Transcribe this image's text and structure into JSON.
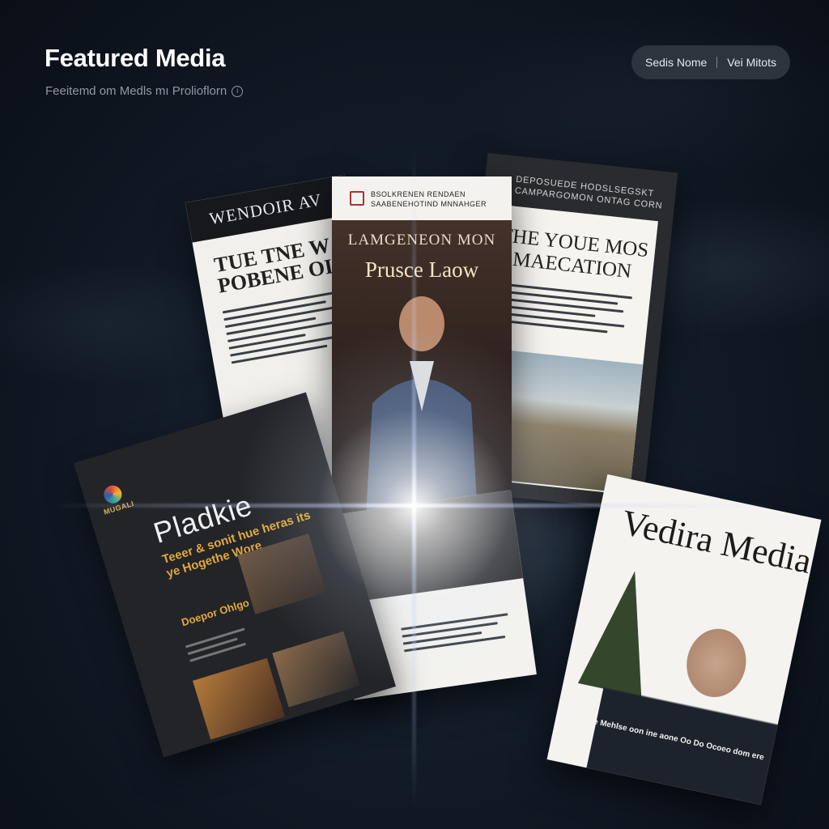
{
  "header": {
    "title": "Featured Media",
    "subtitle": "Feeitemd om Medls mı Prolioflorn"
  },
  "top_pill": {
    "left_label": "Sedis Nome",
    "right_label": "Vei Mitots"
  },
  "cards": {
    "back_left": {
      "masthead": "WENDOIR AV",
      "headline": "TUE TNE W POBENE OI"
    },
    "center": {
      "header": "BSOLKRENEN RENDAEN SAABENEHOTIND MNNAHGER",
      "kicker": "LAMGENEON MON",
      "title": "Prusce Laow"
    },
    "right": {
      "header": "DEPOSUEDE HODSLSEGSKT CAMPARGOMON ONTAG CORN",
      "title": "THE YOUE MOS MAECATION"
    },
    "brochure": {
      "brand": "MUGALI",
      "title": "Pladkie",
      "tagline": "Teeer & sonit hue heras its ye Hogethe Wore",
      "sub": "Doepor Ohlgo Itaer semel"
    },
    "magazine": {
      "title": "Vedira Media",
      "footer": "Odie Mehlse oon ine aone Oo Do Ocoeo dom ere"
    }
  },
  "colors": {
    "accent": "#e1a93a",
    "background": "#121b27",
    "pill": "#2c343e"
  }
}
